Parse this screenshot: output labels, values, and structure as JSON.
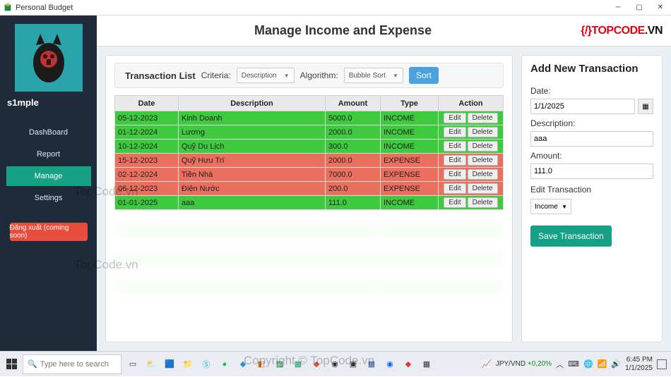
{
  "window": {
    "title": "Personal Budget"
  },
  "sidebar": {
    "username": "s1mple",
    "items": [
      {
        "label": "DashBoard",
        "active": false
      },
      {
        "label": "Report",
        "active": false
      },
      {
        "label": "Manage",
        "active": true
      },
      {
        "label": "Settings",
        "active": false
      }
    ],
    "logout": "Đăng xuất (coming soon)"
  },
  "header": {
    "title": "Manage Income and Expense",
    "logo_top": "TOPCODE",
    "logo_tld": ".VN"
  },
  "filter": {
    "list_label": "Transaction List",
    "criteria_label": "Criteria:",
    "criteria_value": "Description",
    "algo_label": "Algorithm:",
    "algo_value": "Bubble Sort",
    "sort_btn": "Sort"
  },
  "table": {
    "headers": [
      "Date",
      "Description",
      "Amount",
      "Type",
      "Action"
    ],
    "action_edit": "Edit",
    "action_delete": "Delete",
    "rows": [
      {
        "date": "05-12-2023",
        "desc": "Kinh Doanh",
        "amount": "5000.0",
        "type": "INCOME"
      },
      {
        "date": "01-12-2024",
        "desc": "Lương",
        "amount": "2000.0",
        "type": "INCOME"
      },
      {
        "date": "10-12-2024",
        "desc": "Quỹ Du Lịch",
        "amount": "300.0",
        "type": "INCOME"
      },
      {
        "date": "15-12-2023",
        "desc": "Quỹ Hưu Trí",
        "amount": "2000.0",
        "type": "EXPENSE"
      },
      {
        "date": "02-12-2024",
        "desc": "Tiền Nhà",
        "amount": "7000.0",
        "type": "EXPENSE"
      },
      {
        "date": "06-12-2023",
        "desc": "Điện Nước",
        "amount": "200.0",
        "type": "EXPENSE"
      },
      {
        "date": "01-01-2025",
        "desc": "aaa",
        "amount": "111.0",
        "type": "INCOME"
      }
    ]
  },
  "form": {
    "title": "Add New Transaction",
    "date_label": "Date:",
    "date_value": "1/1/2025",
    "desc_label": "Description:",
    "desc_value": "aaa",
    "amount_label": "Amount:",
    "amount_value": "111.0",
    "edit_label": "Edit Transaction",
    "type_value": "Income",
    "save_btn": "Save Transaction"
  },
  "watermark": "TopCode.vn",
  "copyright": "Copyright © TopCode.vn",
  "taskbar": {
    "search_placeholder": "Type here to search",
    "currency_pair": "JPY/VND",
    "currency_change": "+0,20%",
    "time": "6:45 PM",
    "date": "1/1/2025"
  }
}
